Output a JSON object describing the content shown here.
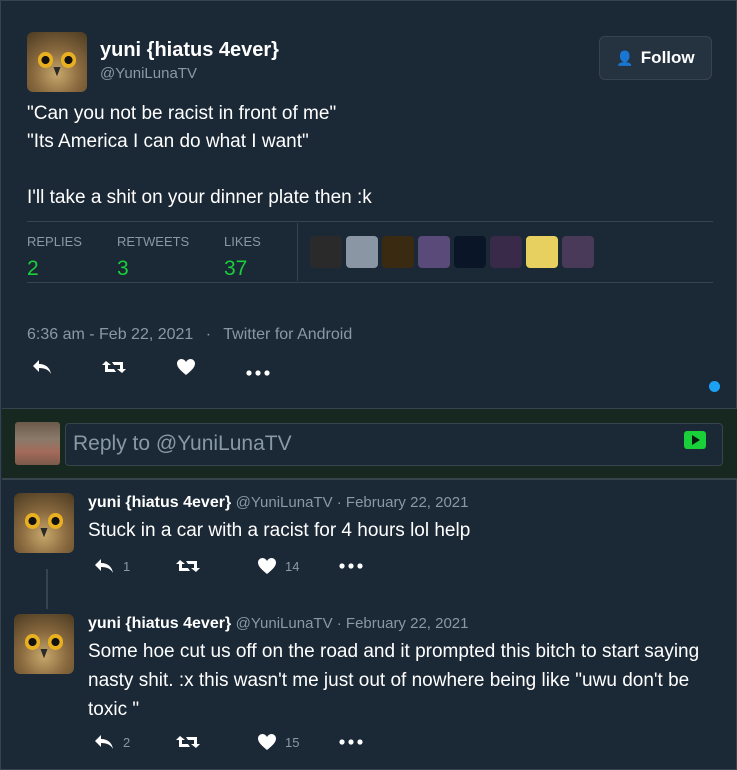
{
  "tweet": {
    "display_name": "yuni {hiatus 4ever}",
    "handle": "@YuniLunaTV",
    "follow_label": "Follow",
    "text": "\"Can you not be racist in front of me\"\n\"Its America I can do what I want\"\n\nI'll take a shit on your dinner plate then :k",
    "stats": {
      "replies_label": "REPLIES",
      "replies": "2",
      "retweets_label": "RETWEETS",
      "retweets": "3",
      "likes_label": "LIKES",
      "likes": "37"
    },
    "timestamp": "6:36 am - Feb 22, 2021",
    "client": "Twitter for Android"
  },
  "liker_colors": [
    "#2a2a2a",
    "#8a96a3",
    "#3a2a12",
    "#5a4a7a",
    "#0a1628",
    "#3a2a4a",
    "#e8d060",
    "#4a3a5a"
  ],
  "reply_box": {
    "placeholder": "Reply to @YuniLunaTV"
  },
  "replies": [
    {
      "name": "yuni {hiatus 4ever}",
      "meta": "@YuniLunaTV · February 22, 2021",
      "text": "Stuck in a car with a racist for 4 hours lol help",
      "reply_count": "1",
      "like_count": "14"
    },
    {
      "name": "yuni {hiatus 4ever}",
      "meta": "@YuniLunaTV · February 22, 2021",
      "text": "Some hoe cut us off on the road and it prompted this bitch to start saying nasty shit. :x this wasn't me just out of nowhere being like \"uwu don't be toxic \"",
      "reply_count": "2",
      "like_count": "15"
    }
  ],
  "colors": {
    "accent_green": "#19cf3a",
    "muted": "#8899a6",
    "background": "#1b2836",
    "blue_dot": "#1da1f2"
  },
  "icons": [
    "follow-person-icon",
    "reply-icon",
    "retweet-icon",
    "heart-icon",
    "more-icon",
    "send-icon"
  ]
}
